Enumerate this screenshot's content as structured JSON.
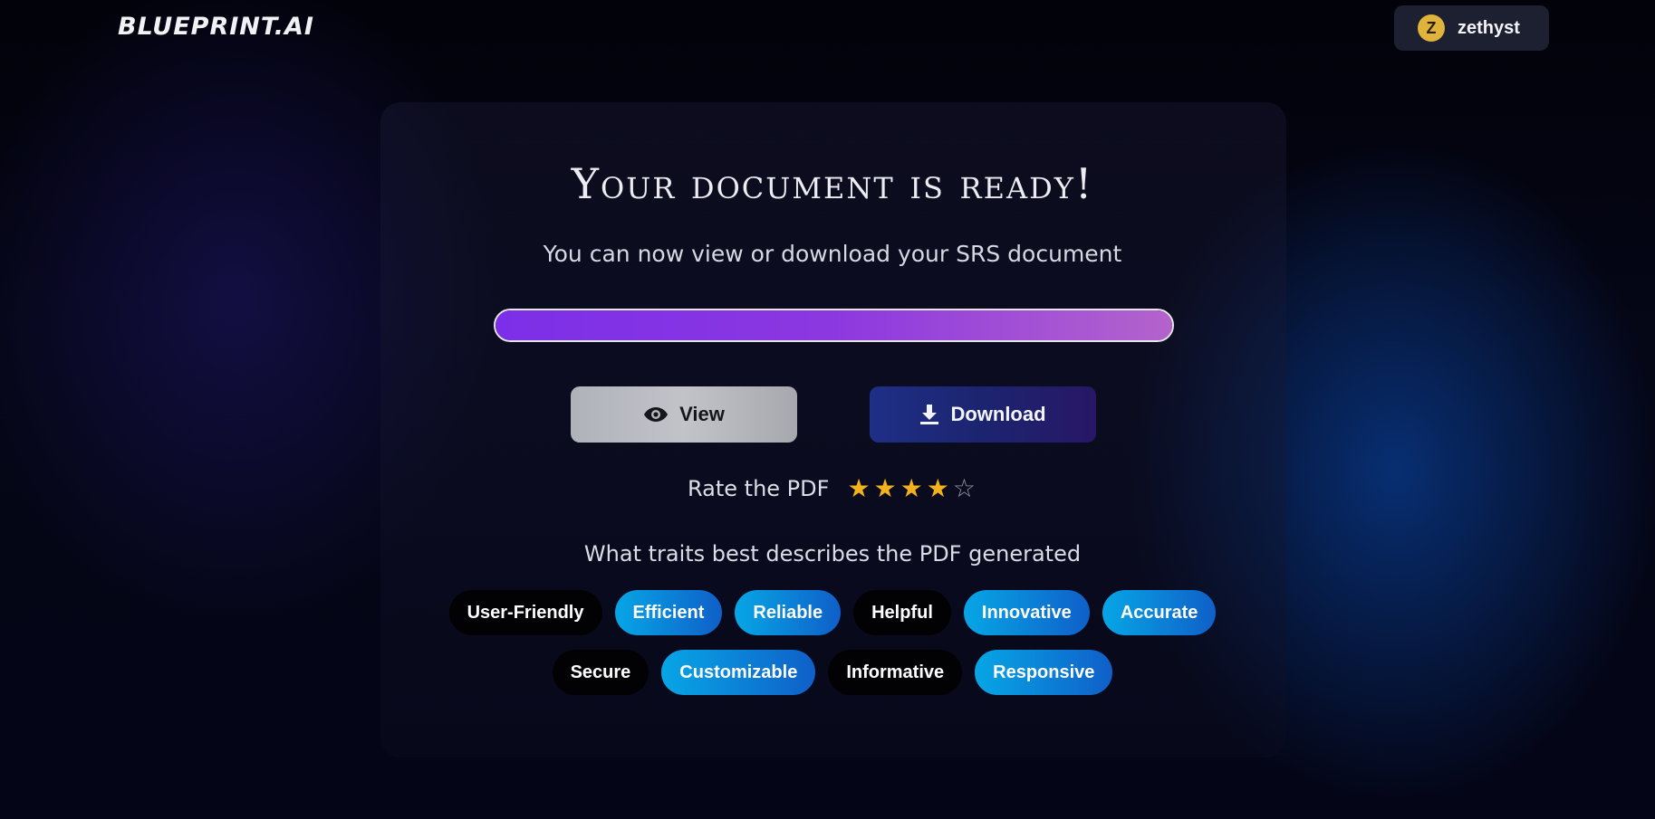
{
  "app": {
    "logo": "BLUEPRINT.AI"
  },
  "user": {
    "initial": "Z",
    "name": "zethyst"
  },
  "main": {
    "title": "Your document is ready!",
    "subtitle": "You can now view or download your SRS document",
    "progress": 1.0
  },
  "actions": {
    "view_label": "View",
    "view_icon": "eye-icon",
    "download_label": "Download",
    "download_icon": "download-icon"
  },
  "rating": {
    "label": "Rate the PDF",
    "value": 4,
    "max": 5
  },
  "traits": {
    "question": "What traits best describes the PDF generated",
    "row1": [
      {
        "label": "User-Friendly",
        "selected": false
      },
      {
        "label": "Efficient",
        "selected": true
      },
      {
        "label": "Reliable",
        "selected": true
      },
      {
        "label": "Helpful",
        "selected": false
      },
      {
        "label": "Innovative",
        "selected": true
      },
      {
        "label": "Accurate",
        "selected": true
      }
    ],
    "row2": [
      {
        "label": "Secure",
        "selected": false
      },
      {
        "label": "Customizable",
        "selected": true
      },
      {
        "label": "Informative",
        "selected": false
      },
      {
        "label": "Responsive",
        "selected": true
      }
    ]
  },
  "colors": {
    "accent_purple": "#7c2fe8",
    "selected_chip": "#07a6e6",
    "star": "#f2b21c"
  }
}
